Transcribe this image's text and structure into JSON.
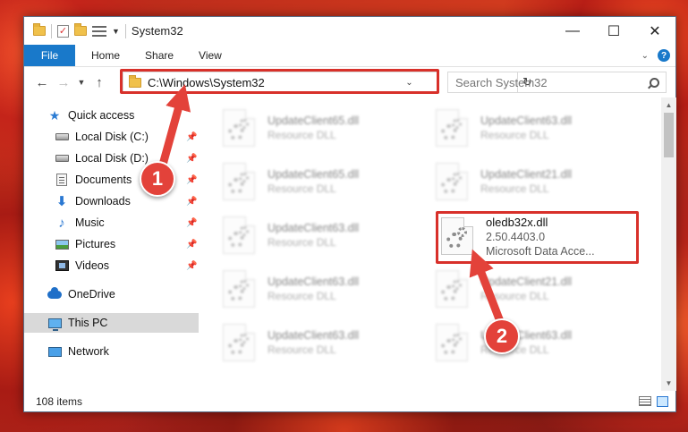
{
  "window": {
    "title": "System32"
  },
  "ribbon": {
    "tabs": [
      "File",
      "Home",
      "Share",
      "View"
    ],
    "accent": "#1979ca"
  },
  "navbar": {
    "address": "C:\\Windows\\System32",
    "search_placeholder": "Search System32"
  },
  "sidebar": {
    "items": [
      {
        "label": "Quick access",
        "icon": "star-icon"
      },
      {
        "label": "Local Disk (C:)",
        "icon": "disk-icon",
        "pinned": true
      },
      {
        "label": "Local Disk (D:)",
        "icon": "disk-icon",
        "pinned": true
      },
      {
        "label": "Documents",
        "icon": "documents-icon",
        "pinned": true
      },
      {
        "label": "Downloads",
        "icon": "download-icon",
        "pinned": true
      },
      {
        "label": "Music",
        "icon": "music-icon",
        "pinned": true
      },
      {
        "label": "Pictures",
        "icon": "pictures-icon",
        "pinned": true
      },
      {
        "label": "Videos",
        "icon": "videos-icon",
        "pinned": true
      },
      {
        "label": "OneDrive",
        "icon": "cloud-icon"
      },
      {
        "label": "This PC",
        "icon": "pc-icon",
        "selected": true
      },
      {
        "label": "Network",
        "icon": "network-icon"
      }
    ]
  },
  "files": [
    {
      "name": "UpdateClient65.dll",
      "type": "Resource DLL"
    },
    {
      "name": "UpdateClient63.dll",
      "type": "Resource DLL"
    },
    {
      "name": "UpdateClient65.dll",
      "type": "Resource DLL"
    },
    {
      "name": "UpdateClient21.dll",
      "type": "Resource DLL"
    },
    {
      "name": "UpdateClient63.dll",
      "type": "Resource DLL"
    },
    {
      "name": "oledb32x.dll",
      "version": "2.50.4403.0",
      "type": "Microsoft Data Acce..."
    },
    {
      "name": "UpdateClient63.dll",
      "type": "Resource DLL"
    },
    {
      "name": "UpdateClient21.dll",
      "type": "Resource DLL"
    },
    {
      "name": "UpdateClient63.dll",
      "type": "Resource DLL"
    },
    {
      "name": "UpdateClient63.dll",
      "type": "Resource DLL"
    }
  ],
  "status": {
    "count": "108 items"
  },
  "callouts": {
    "one": "1",
    "two": "2",
    "color": "#e3423a"
  }
}
